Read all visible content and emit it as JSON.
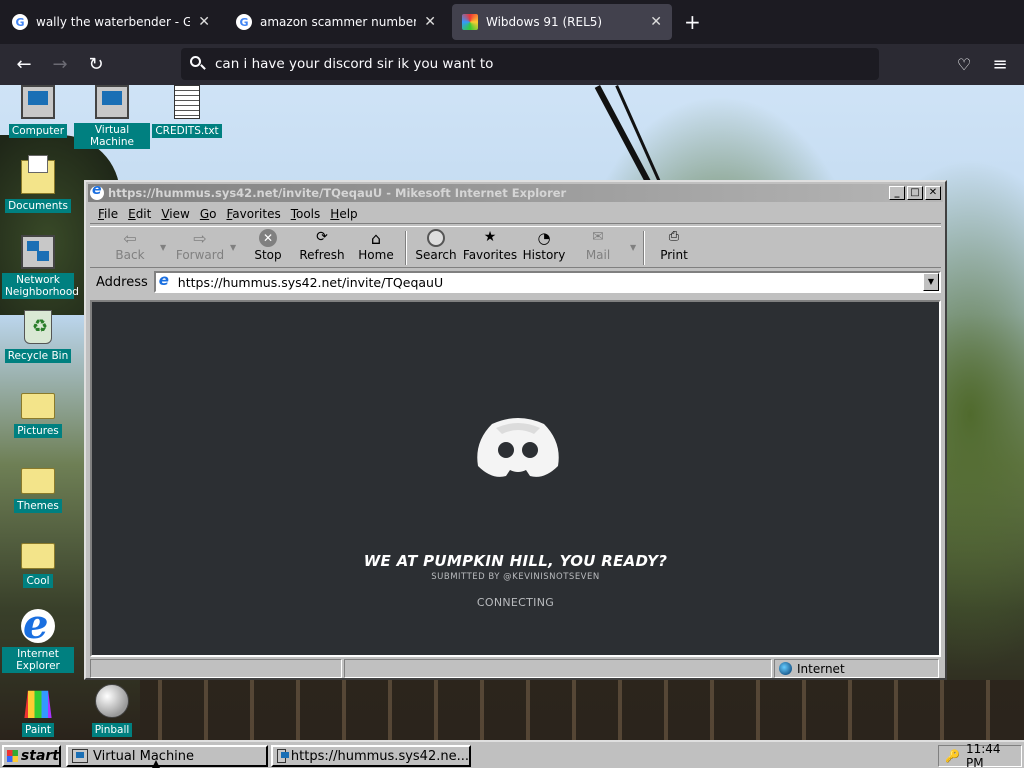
{
  "browser": {
    "tabs": [
      {
        "title": "wally the waterbender - Google",
        "icon": "google-icon",
        "active": false
      },
      {
        "title": "amazon scammer numbers - Go",
        "icon": "google-icon",
        "active": false
      },
      {
        "title": "Wibdows 91 (REL5)",
        "icon": "windows-icon",
        "active": true
      }
    ],
    "close_glyph": "✕",
    "newtab_glyph": "+",
    "back_glyph": "←",
    "forward_glyph": "→",
    "reload_glyph": "↻",
    "url_text": "can i have your discord sir ik you want to",
    "pocket_glyph": "♡",
    "menu_glyph": "≡"
  },
  "desktop": {
    "icons": [
      {
        "label": "Computer",
        "icon": "computer-icon"
      },
      {
        "label": "Virtual Machine",
        "icon": "virtual-machine-icon"
      },
      {
        "label": "CREDITS.txt",
        "icon": "text-file-icon"
      },
      {
        "label": "Documents",
        "icon": "documents-folder-icon"
      },
      {
        "label": "Network Neighborhood",
        "icon": "network-icon"
      },
      {
        "label": "Recycle Bin",
        "icon": "recycle-bin-icon"
      },
      {
        "label": "Pictures",
        "icon": "folder-icon"
      },
      {
        "label": "Themes",
        "icon": "folder-icon"
      },
      {
        "label": "Cool",
        "icon": "folder-icon"
      },
      {
        "label": "Internet Explorer",
        "icon": "internet-explorer-icon"
      },
      {
        "label": "Paint",
        "icon": "paint-icon"
      },
      {
        "label": "Pinball",
        "icon": "pinball-icon"
      }
    ]
  },
  "ie": {
    "title": "https://hummus.sys42.net/invite/TQeqauU - Mikesoft Internet Explorer",
    "title_buttons": {
      "minimize": "_",
      "maximize": "□",
      "close": "✕"
    },
    "menu": [
      "File",
      "Edit",
      "View",
      "Go",
      "Favorites",
      "Tools",
      "Help"
    ],
    "toolbar": {
      "back": "Back",
      "forward": "Forward",
      "stop": "Stop",
      "refresh": "Refresh",
      "home": "Home",
      "search": "Search",
      "favorites": "Favorites",
      "history": "History",
      "mail": "Mail",
      "print": "Print"
    },
    "address_label": "Address",
    "address_value": "https://hummus.sys42.net/invite/TQeqauU",
    "page": {
      "headline": "WE AT PUMPKIN HILL, YOU READY?",
      "submitted_by": "SUBMITTED BY @KEVINISNOTSEVEN",
      "status": "CONNECTING"
    },
    "status_zone": "Internet"
  },
  "taskbar": {
    "start": "start",
    "tasks": [
      "Virtual Machine",
      "https://hummus.sys42.ne..."
    ],
    "clock": "11:44 PM"
  },
  "colors": {
    "desktop_label_bg": "#008080",
    "discord_bg": "#2c2f33",
    "firefox_dark": "#1c1b22"
  }
}
